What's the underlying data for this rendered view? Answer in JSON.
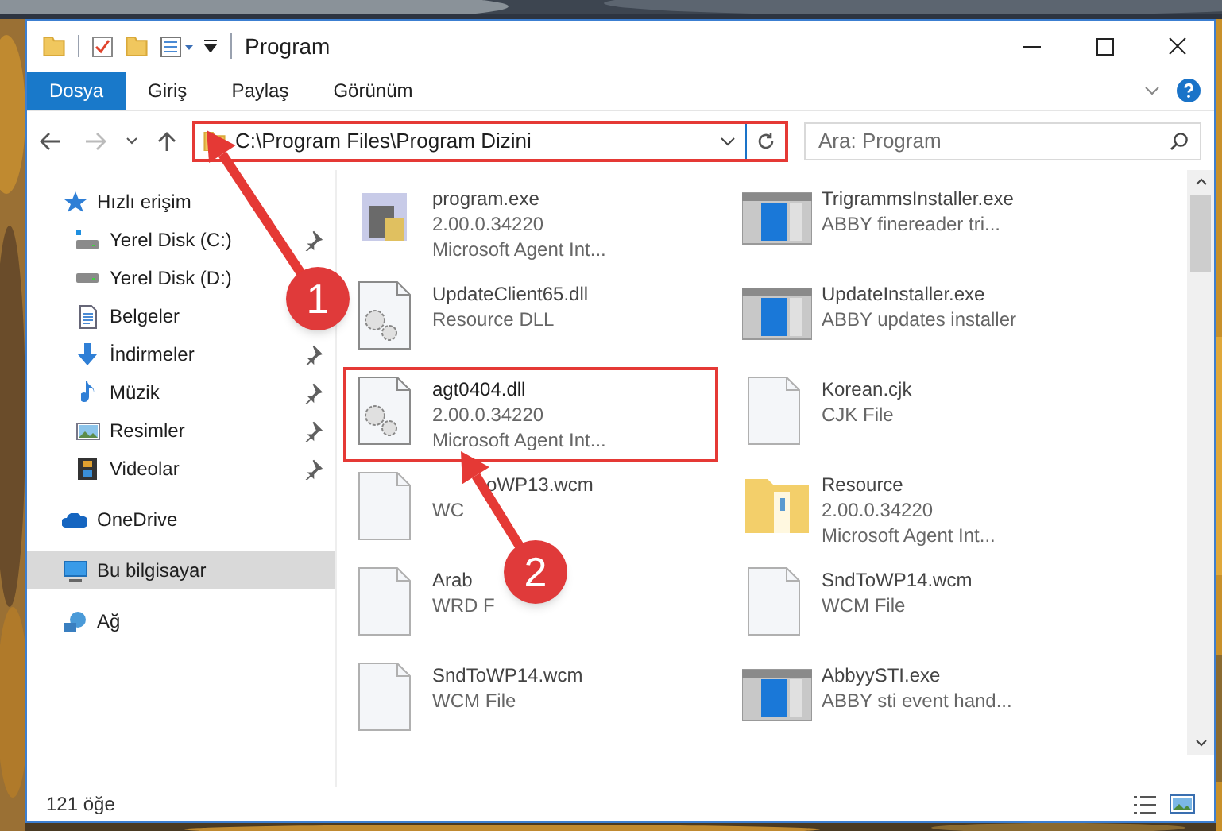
{
  "window": {
    "title": "Program"
  },
  "ribbon_tabs": [
    {
      "label": "Dosya",
      "selected": true
    },
    {
      "label": "Giriş",
      "selected": false
    },
    {
      "label": "Paylaş",
      "selected": false
    },
    {
      "label": "Görünüm",
      "selected": false
    }
  ],
  "address_bar": {
    "path": "C:\\Program Files\\Program Dizini",
    "highlighted": true
  },
  "search": {
    "placeholder": "Ara: Program"
  },
  "sidebar": {
    "items": [
      {
        "label": "Hızlı erişim",
        "kind": "star",
        "selected": false,
        "children": [
          {
            "label": "Yerel Disk (C:)",
            "kind": "drive-c",
            "pinned": true,
            "selected": false
          },
          {
            "label": "Yerel Disk (D:)",
            "kind": "drive",
            "pinned": false,
            "selected": false
          },
          {
            "label": "Belgeler",
            "kind": "document",
            "pinned": false,
            "selected": false
          },
          {
            "label": "İndirmeler",
            "kind": "download",
            "pinned": true,
            "selected": false
          },
          {
            "label": "Müzik",
            "kind": "music",
            "pinned": true,
            "selected": false
          },
          {
            "label": "Resimler",
            "kind": "pictures",
            "pinned": true,
            "selected": false
          },
          {
            "label": "Videolar",
            "kind": "video",
            "pinned": true,
            "selected": false
          }
        ]
      },
      {
        "label": "OneDrive",
        "kind": "cloud",
        "selected": false
      },
      {
        "label": "Bu bilgisayar",
        "kind": "computer",
        "selected": true
      },
      {
        "label": "Ağ",
        "kind": "network",
        "selected": false
      }
    ]
  },
  "files": [
    {
      "name": "program.exe",
      "details": [
        "2.00.0.34220",
        "Microsoft Agent Int..."
      ],
      "kind": "app",
      "highlighted": false
    },
    {
      "name": "TrigrammsInstaller.exe",
      "details": [
        "ABBY finereader tri..."
      ],
      "kind": "installer",
      "highlighted": false
    },
    {
      "name": "UpdateClient65.dll",
      "details": [
        "Resource DLL"
      ],
      "kind": "dll",
      "highlighted": false
    },
    {
      "name": "UpdateInstaller.exe",
      "details": [
        "ABBY updates installer"
      ],
      "kind": "installer",
      "highlighted": false
    },
    {
      "name": "agt0404.dll",
      "details": [
        "2.00.0.34220",
        "Microsoft Agent Int..."
      ],
      "kind": "dll",
      "highlighted": true
    },
    {
      "name": "Korean.cjk",
      "details": [
        "CJK File"
      ],
      "kind": "blank",
      "highlighted": false
    },
    {
      "name": "oWP13.wcm",
      "details": [
        "WC"
      ],
      "kind": "blank",
      "highlighted": false
    },
    {
      "name": "Resource",
      "details": [
        "2.00.0.34220",
        "Microsoft Agent Int..."
      ],
      "kind": "folder",
      "highlighted": false
    },
    {
      "name": "Arab",
      "details": [
        "WRD F"
      ],
      "kind": "blank",
      "highlighted": false
    },
    {
      "name": "SndToWP14.wcm",
      "details": [
        "WCM File"
      ],
      "kind": "blank",
      "highlighted": false
    },
    {
      "name": "SndToWP14.wcm",
      "details": [
        "WCM File"
      ],
      "kind": "blank",
      "highlighted": false
    },
    {
      "name": "AbbyySTI.exe",
      "details": [
        "ABBY sti event hand..."
      ],
      "kind": "installer",
      "highlighted": false
    }
  ],
  "status_bar": {
    "count": "121 öğe"
  },
  "annotations": [
    {
      "label": "1"
    },
    {
      "label": "2"
    }
  ]
}
